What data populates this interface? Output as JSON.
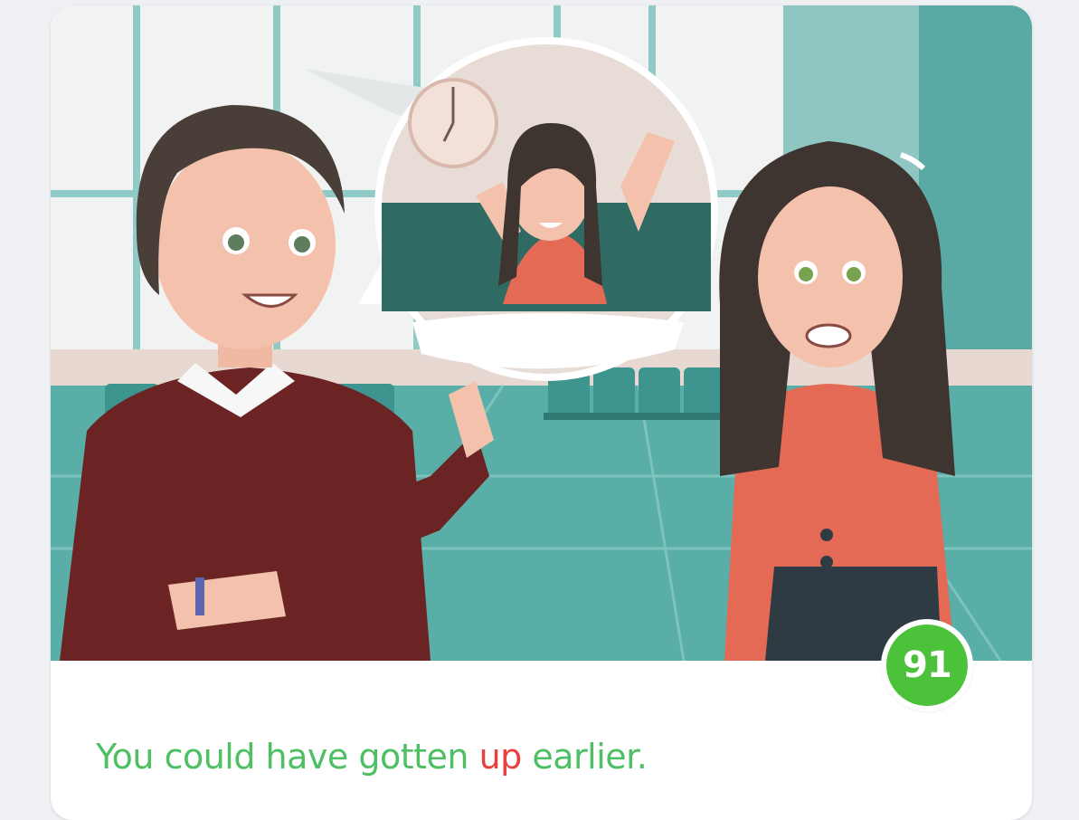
{
  "lesson_card": {
    "illustration": {
      "icon": "airport-scene-illustration",
      "description_colors": {
        "wall": "#e9ecec",
        "window_frame": "#7cc2bf",
        "floor": "#5ab0aa",
        "man_sweater": "#6b2324",
        "woman_top": "#e46a55",
        "hair": "#3e3430"
      }
    },
    "score": "91",
    "score_color": "#4cc23a",
    "sentence": {
      "part1": "You could have gotten ",
      "highlight": "up",
      "part2": " earlier."
    },
    "colors": {
      "correct": "#4ebf63",
      "incorrect": "#e8413d"
    }
  }
}
